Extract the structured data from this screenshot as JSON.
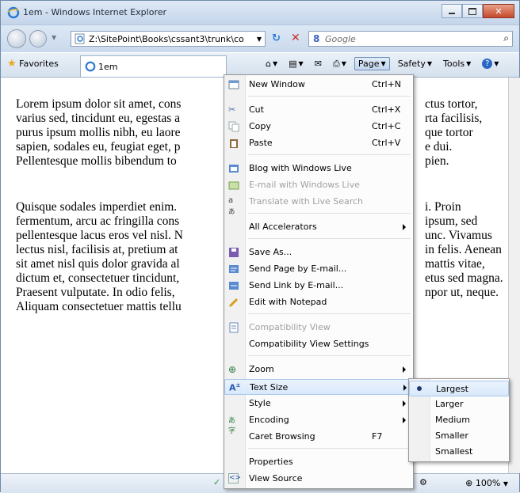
{
  "window": {
    "title": "1em - Windows Internet Explorer",
    "address": "Z:\\SitePoint\\Books\\cssant3\\trunk\\coc",
    "search_placeholder": "Google"
  },
  "toolbar": {
    "favorites": "Favorites",
    "tab_label": "1em",
    "page": "Page",
    "safety": "Safety",
    "tools": "Tools"
  },
  "content": {
    "para1": "Lorem ipsum dolor sit amet, cons\nvarius sed, tincidunt eu, egestas a\npurus ipsum mollis nibh, eu laore\nsapien, sodales eu, feugiat eget, p\nPellentesque mollis bibendum to",
    "para1_right": "ctus tortor,\nrta facilisis,\nque tortor\ne dui.\npien.",
    "para2": "Quisque sodales imperdiet enim.\nfermentum, arcu ac fringilla cons\npellentesque lacus eros vel nisl. N\nlectus nisl, facilisis at, pretium at\nsit amet nisl quis dolor gravida al\ndictum et, consectetuer tincidunt,\nPraesent vulputate. In odio felis,\nAliquam consectetuer mattis tellu",
    "para2_right": "i. Proin\nipsum, sed\nunc. Vivamus\nin felis. Aenean\nmattis vitae,\netus sed magna.\nnpor ut, neque."
  },
  "menu": {
    "new_window": "New Window",
    "new_window_sc": "Ctrl+N",
    "cut": "Cut",
    "cut_sc": "Ctrl+X",
    "copy": "Copy",
    "copy_sc": "Ctrl+C",
    "paste": "Paste",
    "paste_sc": "Ctrl+V",
    "blog": "Blog with Windows Live",
    "email_wl": "E-mail with Windows Live",
    "translate": "Translate with Live Search",
    "accelerators": "All Accelerators",
    "save_as": "Save As...",
    "send_page": "Send Page by E-mail...",
    "send_link": "Send Link by E-mail...",
    "edit_notepad": "Edit with Notepad",
    "compat_view": "Compatibility View",
    "compat_settings": "Compatibility View Settings",
    "zoom": "Zoom",
    "text_size": "Text Size",
    "style": "Style",
    "encoding": "Encoding",
    "caret": "Caret Browsing",
    "caret_sc": "F7",
    "properties": "Properties",
    "view_source": "View Source"
  },
  "submenu": {
    "largest": "Largest",
    "larger": "Larger",
    "medium": "Medium",
    "smaller": "Smaller",
    "smallest": "Smallest"
  },
  "status": {
    "zoom": "100%"
  }
}
